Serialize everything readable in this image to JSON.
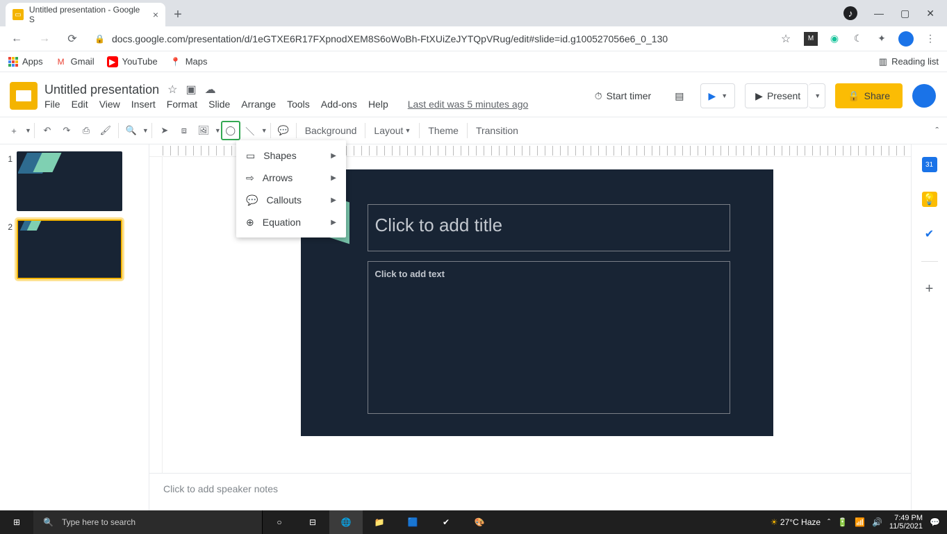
{
  "browser": {
    "tab_title": "Untitled presentation - Google S",
    "url": "docs.google.com/presentation/d/1eGTXE6R17FXpnodXEM8S6oWoBh-FtXUiZeJYTQpVRug/edit#slide=id.g100527056e6_0_130",
    "bookmarks": {
      "apps": "Apps",
      "gmail": "Gmail",
      "youtube": "YouTube",
      "maps": "Maps",
      "reading": "Reading list"
    }
  },
  "doc": {
    "title": "Untitled presentation",
    "menus": {
      "file": "File",
      "edit": "Edit",
      "view": "View",
      "insert": "Insert",
      "format": "Format",
      "slide": "Slide",
      "arrange": "Arrange",
      "tools": "Tools",
      "addons": "Add-ons",
      "help": "Help"
    },
    "last_edit": "Last edit was 5 minutes ago",
    "actions": {
      "timer": "Start timer",
      "present": "Present",
      "share": "Share"
    }
  },
  "toolbar": {
    "background": "Background",
    "layout": "Layout",
    "theme": "Theme",
    "transition": "Transition"
  },
  "dropdown": {
    "shapes": "Shapes",
    "arrows": "Arrows",
    "callouts": "Callouts",
    "equation": "Equation"
  },
  "filmstrip": {
    "n1": "1",
    "n2": "2"
  },
  "slide": {
    "title_placeholder": "Click to add title",
    "body_placeholder": "Click to add text"
  },
  "notes": {
    "placeholder": "Click to add speaker notes"
  },
  "taskbar": {
    "search_placeholder": "Type here to search",
    "weather": "27°C Haze",
    "time": "7:49 PM",
    "date": "11/5/2021"
  }
}
